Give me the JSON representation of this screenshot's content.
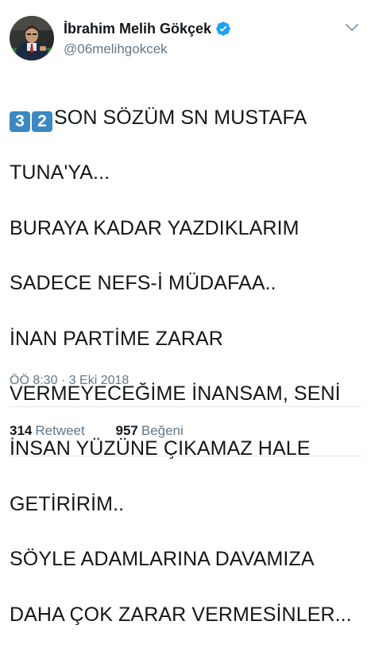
{
  "author": {
    "name": "İbrahim Melih Gökçek",
    "handle": "@06melihgokcek",
    "verified": true
  },
  "tweet": {
    "keycaps": [
      "3",
      "2"
    ],
    "lines": [
      "SON SÖZÜM SN MUSTAFA",
      "TUNA'YA...",
      "BURAYA KADAR YAZDIKLARIM",
      "SADECE NEFS-İ MÜDAFAA..",
      "İNAN PARTİME ZARAR",
      "VERMEYECEĞİME İNANSAM, SENİ",
      "İNSAN YÜZÜNE ÇIKAMAZ HALE",
      "GETİRİRİM..",
      "SÖYLE ADAMLARINA DAVAMIZA",
      "DAHA ÇOK ZARAR VERMESİNLER..."
    ],
    "timestamp": "ÖÖ 8:30 · 3 Eki 2018"
  },
  "stats": {
    "retweets": "314",
    "retweets_label": "Retweet",
    "likes": "957",
    "likes_label": "Beğeni"
  },
  "colors": {
    "text": "#14171a",
    "muted": "#657786",
    "verified": "#1da1f2",
    "keycap": "#3b88c3",
    "divider": "#e1e8ed"
  }
}
